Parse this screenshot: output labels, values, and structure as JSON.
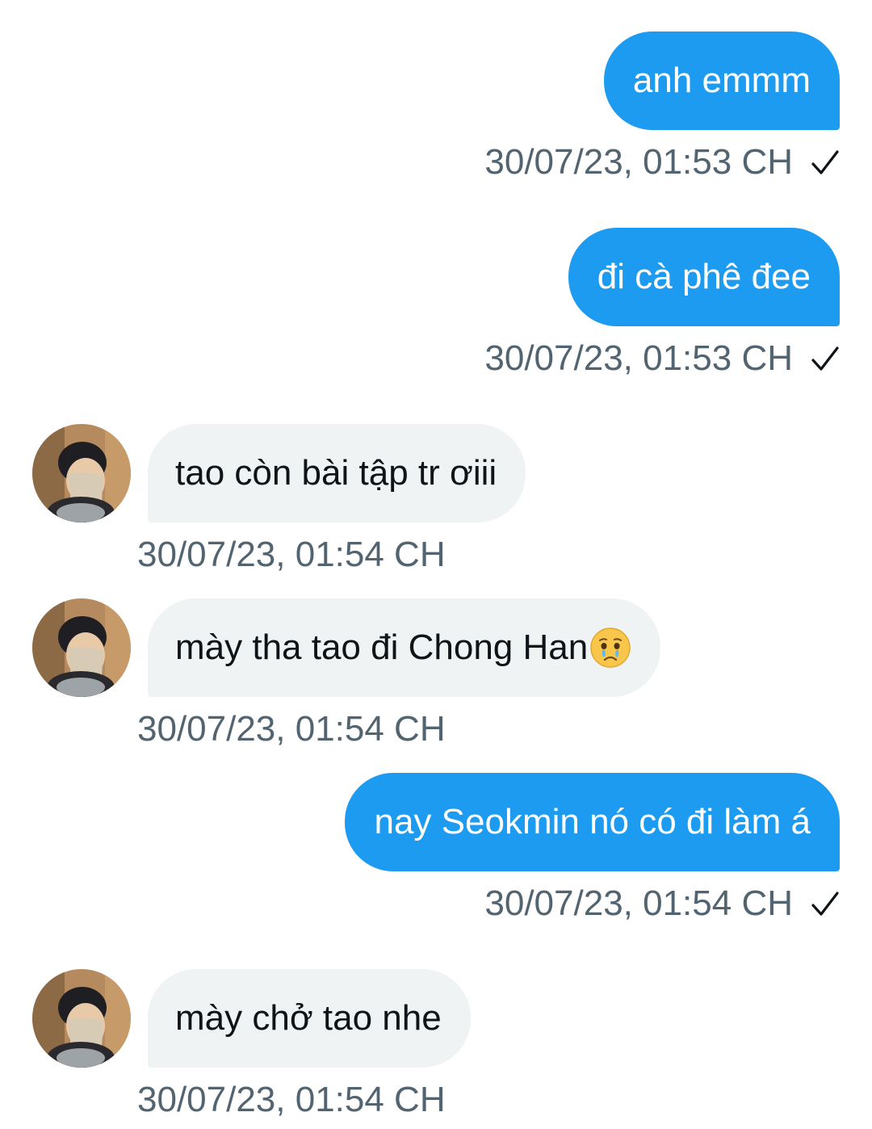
{
  "colors": {
    "outgoing_bubble": "#1d9bf0",
    "incoming_bubble": "#eff3f4",
    "timestamp": "#536471",
    "text_dark": "#0f1419"
  },
  "messages": [
    {
      "direction": "out",
      "text": "anh emmm",
      "timestamp": "30/07/23, 01:53 CH",
      "status_icon": "check-icon"
    },
    {
      "direction": "out",
      "text": "đi cà phê đee",
      "timestamp": "30/07/23, 01:53 CH",
      "status_icon": "check-icon"
    },
    {
      "direction": "in",
      "text": "tao còn bài tập tr ơiii",
      "timestamp": "30/07/23, 01:54 CH",
      "avatar": "user-avatar"
    },
    {
      "direction": "in",
      "text": "mày tha tao đi Chong Han",
      "emoji": "crying-face-emoji",
      "timestamp": "30/07/23, 01:54 CH",
      "avatar": "user-avatar"
    },
    {
      "direction": "out",
      "text": "nay Seokmin nó có đi làm á",
      "timestamp": "30/07/23, 01:54 CH",
      "status_icon": "check-icon"
    },
    {
      "direction": "in",
      "text": "mày chở tao nhe",
      "timestamp": "30/07/23, 01:54 CH",
      "avatar": "user-avatar"
    }
  ]
}
